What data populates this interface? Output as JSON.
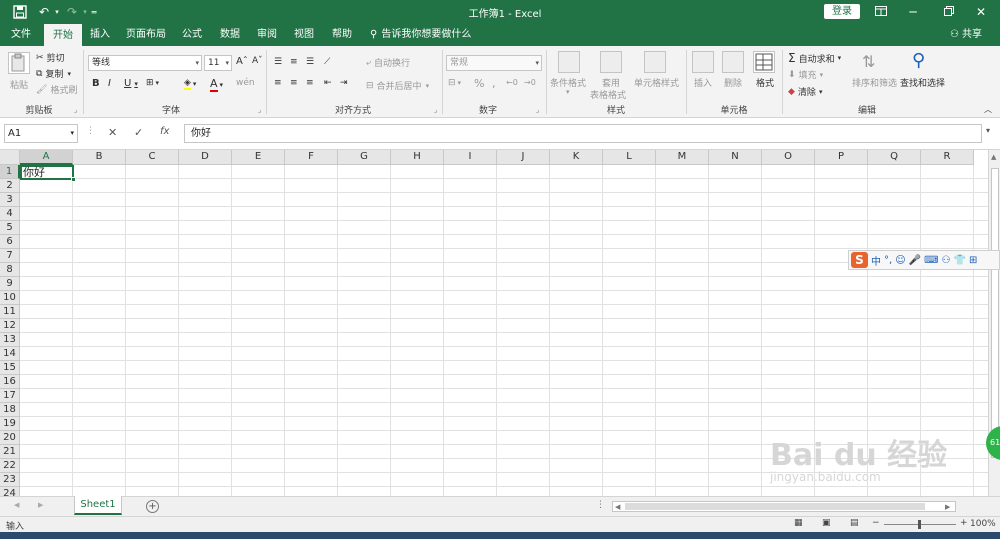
{
  "app": {
    "window_title": "工作簿1 - Excel",
    "login_label": "登录",
    "share_label": "共享",
    "tellme_text": "告诉我你想要做什么"
  },
  "quick_access": {
    "save_icon": "save-icon",
    "undo_icon": "undo-icon",
    "redo_icon": "redo-icon",
    "customize_icon": "customize-qat-icon"
  },
  "tabs": [
    "文件",
    "开始",
    "插入",
    "页面布局",
    "公式",
    "数据",
    "审阅",
    "视图",
    "帮助"
  ],
  "active_tab": "开始",
  "ribbon": {
    "clipboard": {
      "paste_label": "粘贴",
      "cut_label": "剪切",
      "copy_label": "复制",
      "format_painter_label": "格式刷",
      "group_label": "剪贴板"
    },
    "font": {
      "font_name": "等线",
      "font_size": "11",
      "bold": "B",
      "italic": "I",
      "underline": "U",
      "grow": "Aˆ",
      "shrink": "Aˇ",
      "wen": "wén",
      "font_color": "A",
      "group_label": "字体"
    },
    "alignment": {
      "wrap_label": "自动换行",
      "merge_label": "合并后居中",
      "group_label": "对齐方式"
    },
    "number": {
      "format": "常规",
      "percent": "%",
      "comma": ",",
      "group_label": "数字"
    },
    "styles": {
      "conditional_label": "条件格式",
      "table_label_1": "套用",
      "table_label_2": "表格格式",
      "cell_styles_label": "单元格样式",
      "group_label": "样式"
    },
    "cells": {
      "insert_label": "插入",
      "delete_label": "删除",
      "format_label": "格式",
      "group_label": "单元格"
    },
    "editing": {
      "autosum_label": "自动求和",
      "fill_label": "填充",
      "clear_label": "清除",
      "sort_label": "排序和筛选",
      "find_label": "查找和选择",
      "group_label": "编辑"
    }
  },
  "formula_bar": {
    "name_box": "A1",
    "fx_label": "fx",
    "formula": "你好"
  },
  "grid": {
    "columns": [
      "A",
      "B",
      "C",
      "D",
      "E",
      "F",
      "G",
      "H",
      "I",
      "J",
      "K",
      "L",
      "M",
      "N",
      "O",
      "P",
      "Q",
      "R"
    ],
    "rows": [
      "1",
      "2",
      "3",
      "4",
      "5",
      "6",
      "7",
      "8",
      "9",
      "10",
      "11",
      "12",
      "13",
      "14",
      "15",
      "16",
      "17",
      "18",
      "19",
      "20",
      "21",
      "22",
      "23",
      "24"
    ],
    "active_cell": "A1",
    "active_cell_value": "你好"
  },
  "sheets": {
    "tabs": [
      "Sheet1"
    ],
    "add_label": "+"
  },
  "status": {
    "mode": "输入",
    "zoom": "100%"
  },
  "ime": {
    "logo": "S",
    "mode": "中"
  },
  "watermark": {
    "text": "Bai du 经验",
    "subtext": "jingyan.baidu.com"
  },
  "colors": {
    "accent": "#217346",
    "ribbon_bg": "#f3f3f3",
    "gridline": "#e1e1e1"
  }
}
